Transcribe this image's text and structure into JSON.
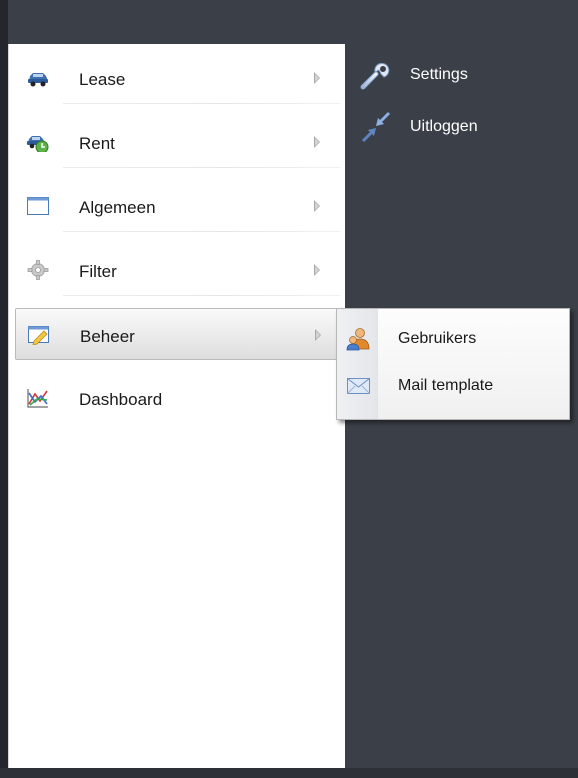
{
  "top_links": [
    {
      "label": "Settings",
      "icon": "wrench-icon"
    },
    {
      "label": "Uitloggen",
      "icon": "logout-arrows-icon"
    }
  ],
  "main_menu": {
    "items": [
      {
        "label": "Lease",
        "icon": "car-icon",
        "has_submenu": true
      },
      {
        "label": "Rent",
        "icon": "car-rent-icon",
        "has_submenu": true
      },
      {
        "label": "Algemeen",
        "icon": "window-icon",
        "has_submenu": true
      },
      {
        "label": "Filter",
        "icon": "gear-icon",
        "has_submenu": true
      },
      {
        "label": "Beheer",
        "icon": "edit-form-icon",
        "has_submenu": true,
        "active": true
      },
      {
        "label": "Dashboard",
        "icon": "chart-icon",
        "has_submenu": false
      }
    ]
  },
  "submenu": {
    "items": [
      {
        "label": "Gebruikers",
        "icon": "users-icon"
      },
      {
        "label": "Mail template",
        "icon": "envelope-icon"
      }
    ]
  },
  "colors": {
    "background": "#3b4048",
    "menu_background": "#ffffff",
    "text": "#1a1a1a",
    "top_link_text": "#ffffff"
  }
}
